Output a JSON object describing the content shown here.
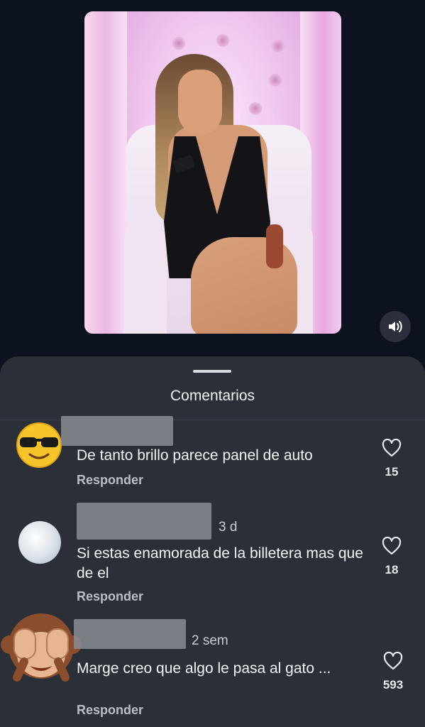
{
  "sheet": {
    "title": "Comentarios"
  },
  "comments": [
    {
      "avatar_icon": "sunglasses-emoji-icon",
      "time": "",
      "text": "De tanto brillo parece panel de auto",
      "reply_label": "Responder",
      "likes": "15"
    },
    {
      "avatar_icon": "profile-photo",
      "time": "3 d",
      "text": "Si estas enamorada de la billetera mas que de el",
      "reply_label": "Responder",
      "likes": "18"
    },
    {
      "avatar_icon": "see-no-evil-monkey-emoji-icon",
      "time": "2 sem",
      "text": "Marge creo que algo le pasa al gato ...",
      "reply_label": "Responder",
      "likes": "593"
    }
  ],
  "colors": {
    "background": "#0d1221",
    "sheet": "#2b2f38",
    "text": "#f2f3f5",
    "muted": "#b9bdc4"
  }
}
